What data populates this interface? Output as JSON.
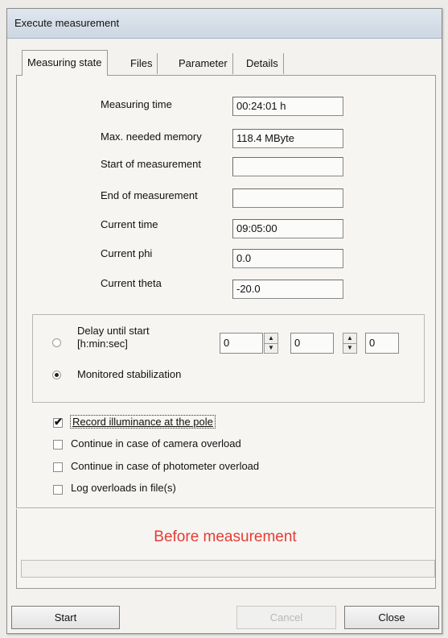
{
  "window": {
    "title": "Execute measurement"
  },
  "tabs": [
    {
      "label": "Measuring state"
    },
    {
      "label": "Files"
    },
    {
      "label": "Parameter"
    },
    {
      "label": "Details"
    }
  ],
  "fields": [
    {
      "label": "Measuring time",
      "value": "00:24:01 h"
    },
    {
      "label": "Max. needed memory",
      "value": "118.4 MByte"
    },
    {
      "label": "Start of measurement",
      "value": ""
    },
    {
      "label": "End of measurement",
      "value": ""
    },
    {
      "label": "Current time",
      "value": "09:05:00"
    },
    {
      "label": "Current phi",
      "value": "0.0"
    },
    {
      "label": "Current theta",
      "value": "-20.0"
    }
  ],
  "start_mode": {
    "delay_label_line1": "Delay until start",
    "delay_label_line2": "[h:min:sec]",
    "delay_h": "0",
    "delay_min": "0",
    "delay_sec": "0",
    "monitored_label": "Monitored stabilization",
    "selected": "monitored"
  },
  "options": [
    {
      "label": "Record illuminance at the pole",
      "checked": true
    },
    {
      "label": "Continue in case of camera overload",
      "checked": false
    },
    {
      "label": "Continue in case of photometer overload",
      "checked": false
    },
    {
      "label": "Log overloads in file(s)",
      "checked": false
    }
  ],
  "status": {
    "text": "Before measurement",
    "color": "#e63b35"
  },
  "buttons": {
    "start": "Start",
    "cancel": "Cancel",
    "close": "Close"
  }
}
